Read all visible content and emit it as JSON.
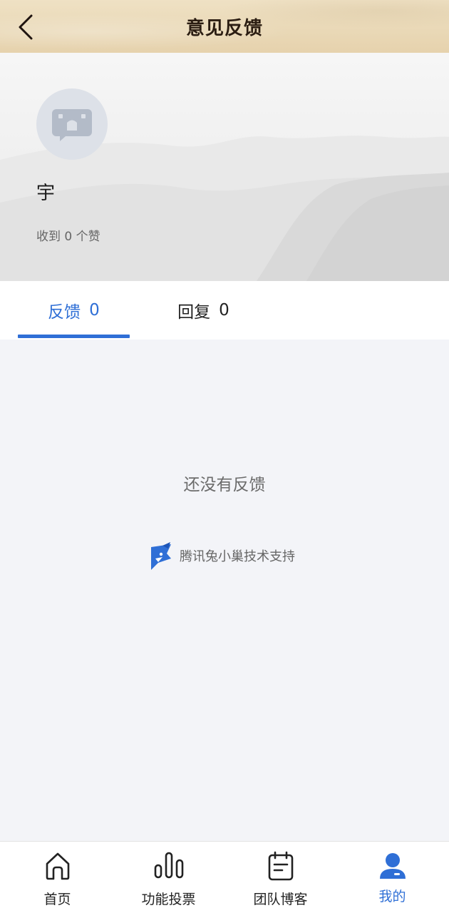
{
  "header": {
    "title": "意见反馈",
    "back_icon": "chevron-left-icon"
  },
  "profile": {
    "avatar_icon": "default-avatar-icon",
    "username": "宇",
    "likes_text": "收到 0 个赞"
  },
  "tabs": [
    {
      "label": "反馈",
      "count": "0",
      "active": true
    },
    {
      "label": "回复",
      "count": "0",
      "active": false
    }
  ],
  "empty_state": {
    "message": "还没有反馈"
  },
  "powered_by": {
    "icon": "tencent-txc-logo-icon",
    "text": "腾讯兔小巢技术支持"
  },
  "bottom_nav": [
    {
      "label": "首页",
      "icon": "home-icon",
      "active": false
    },
    {
      "label": "功能投票",
      "icon": "bar-chart-icon",
      "active": false
    },
    {
      "label": "团队博客",
      "icon": "notepad-icon",
      "active": false
    },
    {
      "label": "我的",
      "icon": "user-icon",
      "active": true
    }
  ],
  "colors": {
    "accent": "#2f6fd6",
    "header_bg": "#e9d8b6",
    "page_bg": "#f3f4f8"
  }
}
